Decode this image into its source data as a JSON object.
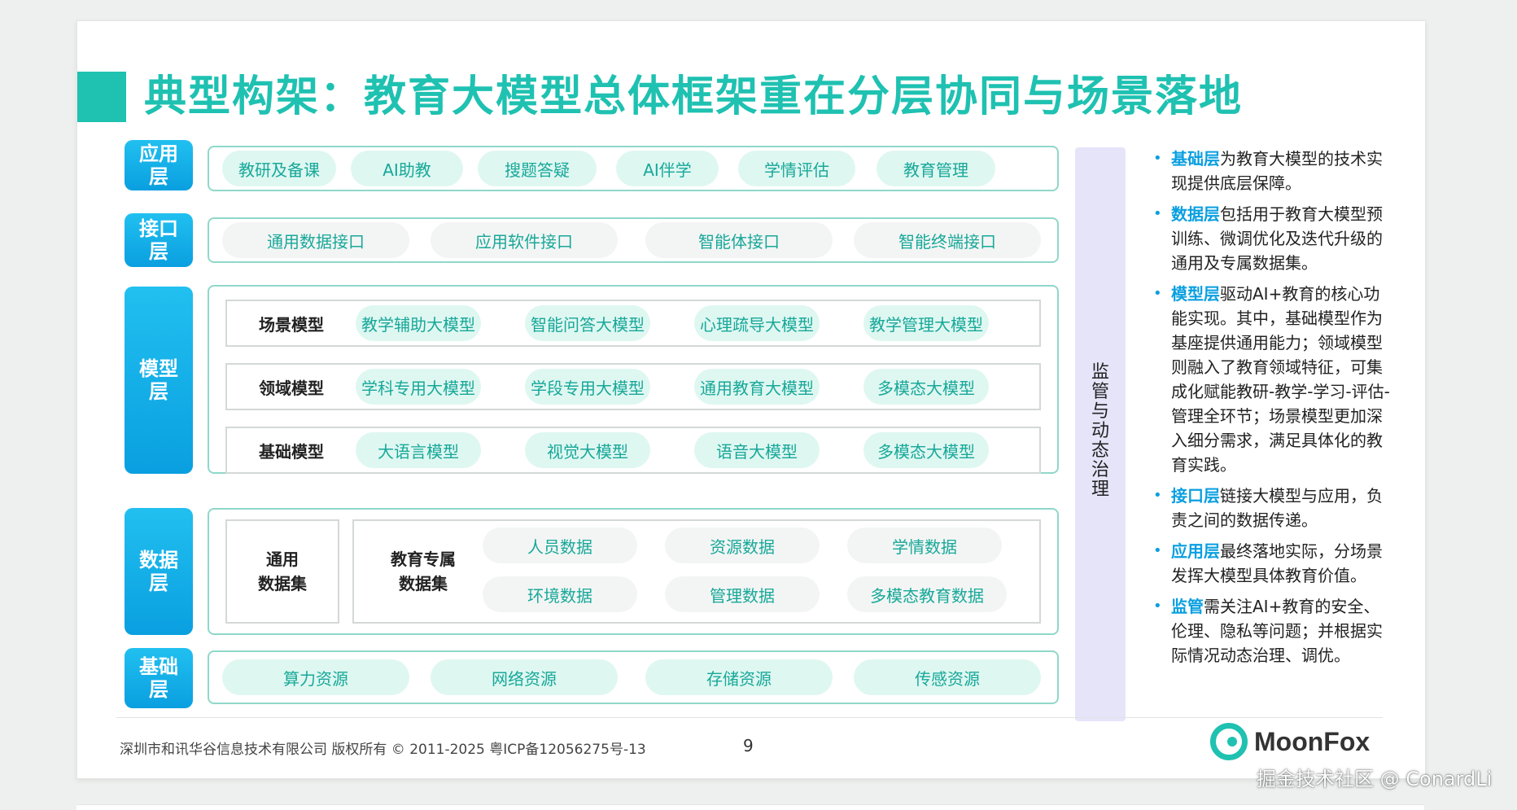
{
  "title": "典型构架：教育大模型总体框架重在分层协同与场景落地",
  "layers": {
    "application": {
      "label": "应用层",
      "items": [
        "教研及备课",
        "AI助教",
        "搜题答疑",
        "AI伴学",
        "学情评估",
        "教育管理"
      ]
    },
    "interface": {
      "label": "接口层",
      "items": [
        "通用数据接口",
        "应用软件接口",
        "智能体接口",
        "智能终端接口"
      ]
    },
    "model": {
      "label": "模型层",
      "rows": [
        {
          "label": "场景模型",
          "items": [
            "教学辅助大模型",
            "智能问答大模型",
            "心理疏导大模型",
            "教学管理大模型"
          ]
        },
        {
          "label": "领域模型",
          "items": [
            "学科专用大模型",
            "学段专用大模型",
            "通用教育大模型",
            "多模态大模型"
          ]
        },
        {
          "label": "基础模型",
          "items": [
            "大语言模型",
            "视觉大模型",
            "语音大模型",
            "多模态大模型"
          ]
        }
      ]
    },
    "data": {
      "label": "数据层",
      "general_label": [
        "通用",
        "数据集"
      ],
      "edu_label": [
        "教育专属",
        "数据集"
      ],
      "items": [
        "人员数据",
        "资源数据",
        "学情数据",
        "环境数据",
        "管理数据",
        "多模态教育数据"
      ]
    },
    "foundation": {
      "label": "基础层",
      "items": [
        "算力资源",
        "网络资源",
        "存储资源",
        "传感资源"
      ]
    }
  },
  "governance_label": "监管与动态治理",
  "notes": [
    {
      "keyword": "基础层",
      "text": "为教育大模型的技术实现提供底层保障。"
    },
    {
      "keyword": "数据层",
      "text": "包括用于教育大模型预训练、微调优化及迭代升级的通用及专属数据集。"
    },
    {
      "keyword": "模型层",
      "text": "驱动AI+教育的核心功能实现。其中，基础模型作为基座提供通用能力；领域模型则融入了教育领域特征，可集成化赋能教研-教学-学习-评估-管理全环节；场景模型更加深入细分需求，满足具体化的教育实践。"
    },
    {
      "keyword": "接口层",
      "text": "链接大模型与应用，负责之间的数据传递。"
    },
    {
      "keyword": "应用层",
      "text": "最终落地实际，分场景发挥大模型具体教育价值。"
    },
    {
      "keyword": "监管",
      "text": "需关注AI+教育的安全、伦理、隐私等问题；并根据实际情况动态治理、调优。"
    }
  ],
  "footer": {
    "copyright": "深圳市和讯华谷信息技术有限公司 版权所有 © 2011-2025 粤ICP备12056275号-13",
    "page_number": "9",
    "logo_text": "MoonFox"
  },
  "watermark": "掘金技术社区 @ ConardLi",
  "colors": {
    "accent_teal": "#1fc1b1",
    "label_blue": "#0a9fe0",
    "pill_bg": "#dff7f1",
    "governance_bg": "#e6e4f9"
  }
}
